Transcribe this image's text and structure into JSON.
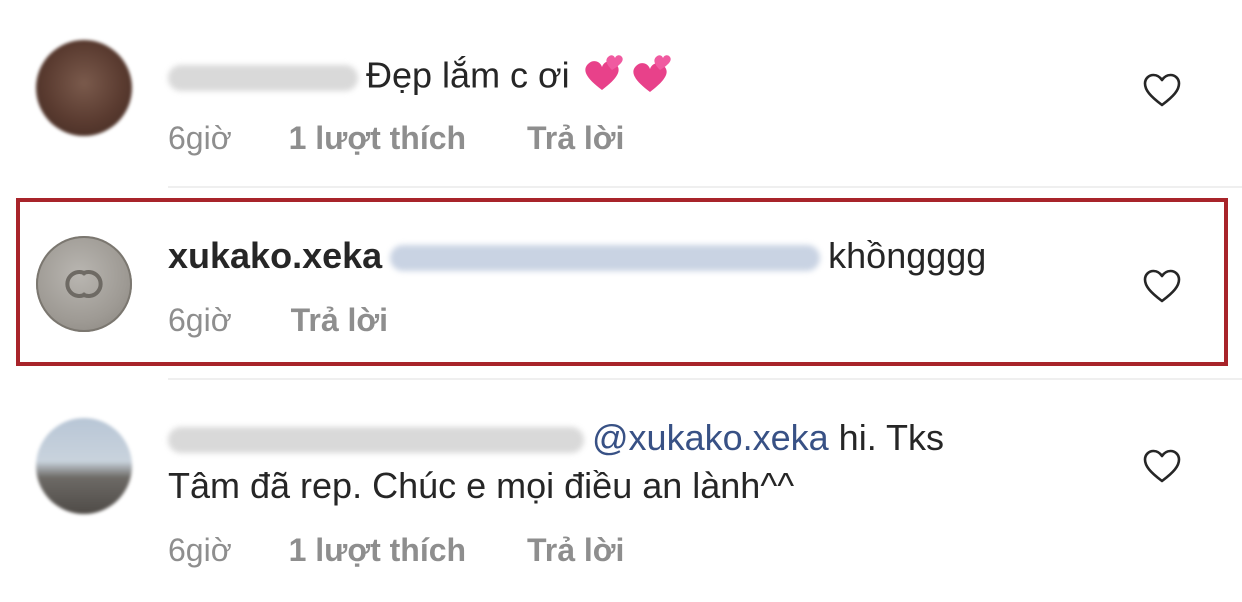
{
  "comments": [
    {
      "username": "",
      "text": "Đẹp lắm c ơi",
      "emoji": "💕 💕",
      "time": "6giờ",
      "likes": "1 lượt thích",
      "reply": "Trả lời",
      "avatar_icon": "avatar-photo"
    },
    {
      "username": "xukako.xeka",
      "text": "khồngggg",
      "time": "6giờ",
      "reply": "Trả lời",
      "avatar_icon": "chanel-logo-avatar"
    },
    {
      "username": "",
      "mention": "@xukako.xeka",
      "text_line1": "hi. Tks",
      "text_line2": "Tâm đã rep. Chúc e mọi điều an lành^^",
      "time": "6giờ",
      "likes": "1 lượt thích",
      "reply": "Trả lời",
      "avatar_icon": "landscape-avatar"
    }
  ],
  "colors": {
    "highlight_border": "#a8242a",
    "mention": "#385185",
    "meta": "#8e8e8e"
  },
  "icons": {
    "like": "heart-outline-icon"
  }
}
